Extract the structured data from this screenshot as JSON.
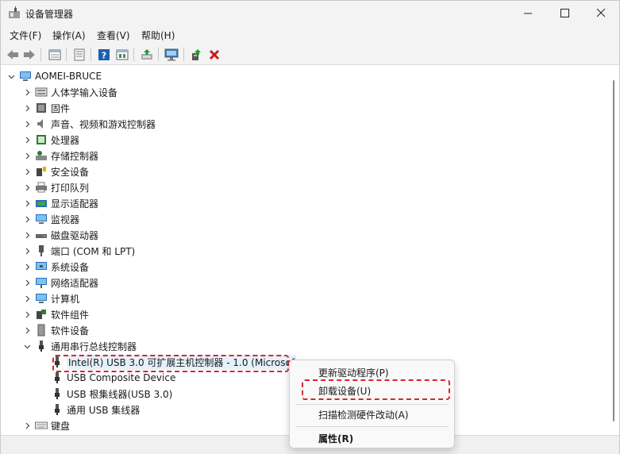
{
  "window": {
    "title": "设备管理器",
    "controls": {
      "minimize": "—",
      "maximize": "☐",
      "close": "✕"
    }
  },
  "menu": {
    "file": "文件(F)",
    "action": "操作(A)",
    "view": "查看(V)",
    "help": "帮助(H)"
  },
  "toolbar": {
    "icons": [
      "back-arrow-icon",
      "forward-arrow-icon",
      "properties-icon",
      "driver-icon",
      "help-icon",
      "show-hidden-icon",
      "update-driver-icon",
      "scan-hardware-icon",
      "add-driver-icon",
      "uninstall-icon"
    ],
    "colors": {
      "help": "#1c5fb0",
      "delete": "#d0161d",
      "arrow": "#7a7a7a",
      "green": "#1f9b2d"
    }
  },
  "tree": {
    "root": "AOMEI-BRUCE",
    "categories": [
      "人体学输入设备",
      "固件",
      "声音、视频和游戏控制器",
      "处理器",
      "存储控制器",
      "安全设备",
      "打印队列",
      "显示适配器",
      "监视器",
      "磁盘驱动器",
      "端口 (COM 和 LPT)",
      "系统设备",
      "网络适配器",
      "计算机",
      "软件组件",
      "软件设备",
      "通用串行总线控制器"
    ],
    "usb_children": [
      "Intel(R) USB 3.0 可扩展主机控制器 - 1.0 (Microsof",
      "USB Composite Device",
      "USB 根集线器(USB 3.0)",
      "通用 USB 集线器"
    ],
    "after": "键盘"
  },
  "context_menu": {
    "update_driver": "更新驱动程序(P)",
    "uninstall": "卸载设备(U)",
    "scan": "扫描检测硬件改动(A)",
    "properties": "属性(R)"
  },
  "colors": {
    "highlight": "#d8262d",
    "selection": "#e5f1fb",
    "chrome": "#f3f3f3"
  }
}
